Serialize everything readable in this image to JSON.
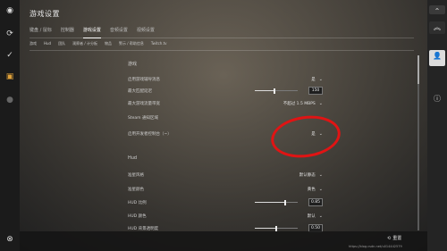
{
  "window": {
    "title": "游戏设置"
  },
  "left_rail": {
    "icons": [
      "steam-icon",
      "refresh-icon",
      "check-icon",
      "notification-icon",
      "dot-icon",
      "close-icon"
    ]
  },
  "right_rail": {
    "icons": [
      "chevron-up-icon",
      "dropdown-icon",
      "user-icon",
      "info-icon"
    ]
  },
  "tabs": [
    {
      "label": "键盘 / 鼠标"
    },
    {
      "label": "控制器"
    },
    {
      "label": "游戏设置"
    },
    {
      "label": "音频设置"
    },
    {
      "label": "视频设置"
    }
  ],
  "subtabs": [
    {
      "label": "游戏"
    },
    {
      "label": "Hud"
    },
    {
      "label": "团队"
    },
    {
      "label": "观察者 / 计分板"
    },
    {
      "label": "物品"
    },
    {
      "label": "警示 / 帮助信息"
    },
    {
      "label": "Twitch.tv"
    }
  ],
  "sections": {
    "game": "游戏",
    "hud": "Hud"
  },
  "game_rows": [
    {
      "label": "启用游戏辅导消息",
      "value": "是"
    },
    {
      "label": "最大匹配延迟",
      "value": "150"
    },
    {
      "label": "最大游戏流量带宽",
      "value": "不超过 1.5 MBPS"
    },
    {
      "label": "Steam 通知区域",
      "value": ""
    },
    {
      "label": "启用开发者控制台（~）",
      "value": "是"
    }
  ],
  "hud_rows": [
    {
      "label": "准星风格",
      "value": "默认静态"
    },
    {
      "label": "准星颜色",
      "value": "黄色"
    },
    {
      "label": "HUD 比例",
      "value": "0.85"
    },
    {
      "label": "HUD 颜色",
      "value": "默认"
    },
    {
      "label": "HUD 背景透明度",
      "value": "0.50"
    }
  ],
  "sliders": {
    "max_latency_level": 0.45,
    "hud_scale_level": 0.7,
    "hud_bg_alpha_level": 0.5
  },
  "bottom": {
    "reset_label": "重置"
  },
  "watermark": "https://blog.csdn.net/u014442579",
  "colors": {
    "annotation": "#e01414"
  }
}
